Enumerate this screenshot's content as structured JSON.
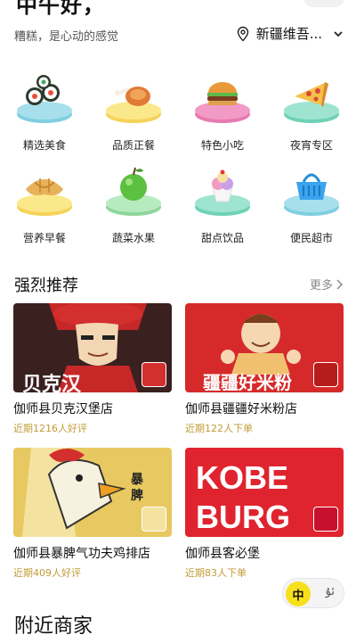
{
  "header": {
    "greeting": "中午好，",
    "slogan": "糟糕，是心动的感觉",
    "location": "新疆维吾...",
    "pin_icon": "location-pin-icon",
    "chevron_icon": "chevron-down-icon"
  },
  "categories": [
    {
      "label": "精选美食",
      "icon": "sushi-icon",
      "plate": "#a7e0ec"
    },
    {
      "label": "品质正餐",
      "icon": "roast-chicken-icon",
      "plate": "#fbe88a"
    },
    {
      "label": "特色小吃",
      "icon": "burger-icon",
      "plate": "#f29ac6"
    },
    {
      "label": "夜宵专区",
      "icon": "pizza-icon",
      "plate": "#9ee4d0"
    },
    {
      "label": "营养早餐",
      "icon": "croissant-icon",
      "plate": "#fbe88a"
    },
    {
      "label": "蔬菜水果",
      "icon": "apple-icon",
      "plate": "#b8eac0"
    },
    {
      "label": "甜点饮品",
      "icon": "ice-cream-icon",
      "plate": "#9ee4d0"
    },
    {
      "label": "便民超市",
      "icon": "shopping-basket-icon",
      "plate": "#a7e0ec"
    }
  ],
  "recommend": {
    "title": "强烈推荐",
    "more": "更多",
    "more_icon": "chevron-right-icon",
    "stores": [
      {
        "name": "伽师县贝克汉堡店",
        "stat": "近期1216人好评"
      },
      {
        "name": "伽师县疆疆好米粉店",
        "stat": "近期122人下单"
      },
      {
        "name": "伽师县暴脾气功夫鸡排店",
        "stat": "近期409人好评"
      },
      {
        "name": "伽师县客必堡",
        "stat": "近期83人下单"
      }
    ]
  },
  "lang_toggle": {
    "active": "中",
    "inactive": "ئۇ"
  },
  "nearby": {
    "title": "附近商家"
  }
}
